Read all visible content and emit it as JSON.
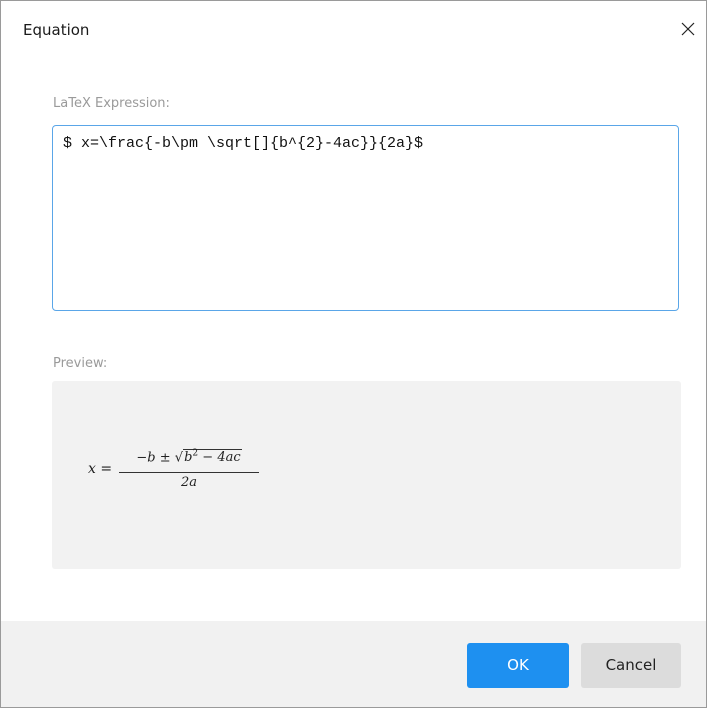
{
  "dialog": {
    "title": "Equation",
    "close_icon": "close-icon"
  },
  "latex": {
    "label": "LaTeX Expression:",
    "value": "$ x=\\frac{-b\\pm \\sqrt[]{b^{2}-4ac}}{2a}$"
  },
  "preview": {
    "label": "Preview:",
    "lhs_var": "x",
    "equals": "=",
    "numerator": {
      "minus": "−",
      "b": "b",
      "pm": "±",
      "radicand_b": "b",
      "exp": "2",
      "minus2": "−",
      "term": "4ac"
    },
    "denominator": "2a"
  },
  "buttons": {
    "ok_label": "OK",
    "cancel_label": "Cancel"
  },
  "colors": {
    "accent": "#1e90f0",
    "input_border": "#5aa6e8",
    "preview_bg": "#f2f2f2",
    "footer_bg": "#f1f1f1"
  }
}
